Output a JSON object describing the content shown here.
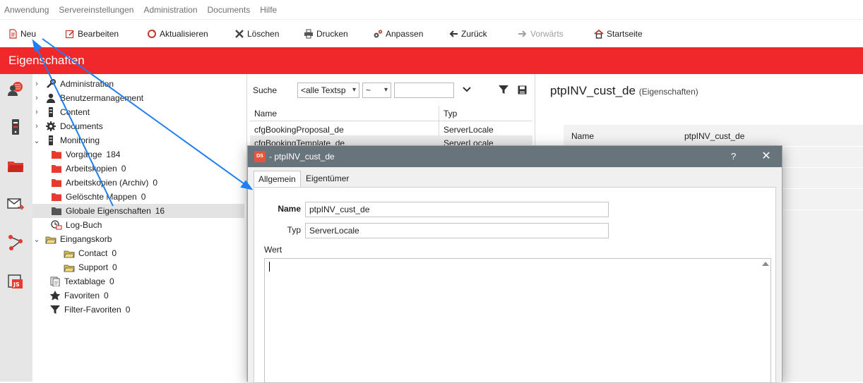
{
  "menu": [
    "Anwendung",
    "Servereinstellungen",
    "Administration",
    "Documents",
    "Hilfe"
  ],
  "toolbar": {
    "neu": "Neu",
    "bearbeiten": "Bearbeiten",
    "aktualisieren": "Aktualisieren",
    "loeschen": "Löschen",
    "drucken": "Drucken",
    "anpassen": "Anpassen",
    "zurueck": "Zurück",
    "vorwaerts": "Vorwärts",
    "startseite": "Startseite"
  },
  "header": {
    "title": "Eigenschaften"
  },
  "tree": {
    "items": [
      {
        "label": "Administration",
        "count": ""
      },
      {
        "label": "Benutzermanagement",
        "count": ""
      },
      {
        "label": "Content",
        "count": ""
      },
      {
        "label": "Documents",
        "count": ""
      },
      {
        "label": "Monitoring",
        "count": ""
      },
      {
        "label": "Vorgänge",
        "count": "184"
      },
      {
        "label": "Arbeitskopien",
        "count": "0"
      },
      {
        "label": "Arbeitskopien (Archiv)",
        "count": "0"
      },
      {
        "label": "Gelöschte Mappen",
        "count": "0"
      },
      {
        "label": "Globale Eigenschaften",
        "count": "16"
      },
      {
        "label": "Log-Buch",
        "count": ""
      },
      {
        "label": "Eingangskorb",
        "count": ""
      },
      {
        "label": "Contact",
        "count": "0"
      },
      {
        "label": "Support",
        "count": "0"
      },
      {
        "label": "Textablage",
        "count": "0"
      },
      {
        "label": "Favoriten",
        "count": "0"
      },
      {
        "label": "Filter-Favoriten",
        "count": "0"
      }
    ]
  },
  "search": {
    "label": "Suche",
    "field_select": "<alle Textsp",
    "operator_select": "~",
    "value": ""
  },
  "grid": {
    "columns": [
      "Name",
      "Typ"
    ],
    "rows": [
      {
        "name": "cfgBookingProposal_de",
        "typ": "ServerLocale"
      },
      {
        "name": "cfgBookingTemplate_de",
        "typ": "ServerLocale"
      }
    ]
  },
  "detail": {
    "title": "ptpINV_cust_de",
    "subtitle": "(Eigenschaften)",
    "name_label": "Name",
    "name_value": "ptpINV_cust_de"
  },
  "dialog": {
    "logo": "DS",
    "title": "- ptpINV_cust_de",
    "help": "?",
    "close": "✕",
    "tabs": [
      "Allgemein",
      "Eigentümer"
    ],
    "name_label": "Name",
    "name_value": "ptpINV_cust_de",
    "typ_label": "Typ",
    "typ_value": "ServerLocale",
    "wert_label": "Wert",
    "wert_value": ""
  },
  "colors": {
    "accent_red": "#f0272b",
    "dialog_title": "#68747b",
    "annotation_arrow": "#1f7ff0"
  }
}
